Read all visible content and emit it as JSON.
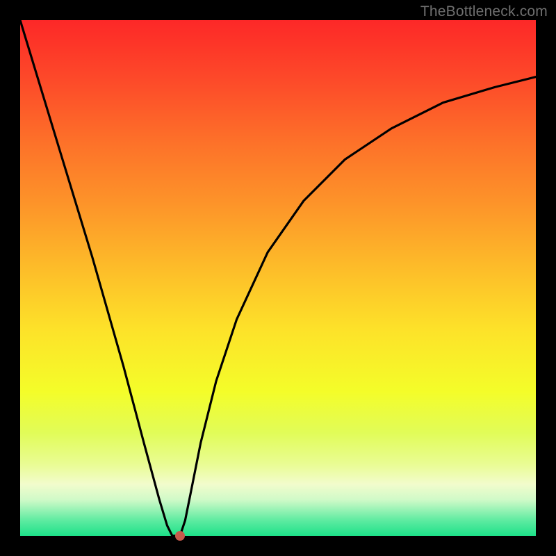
{
  "watermark": "TheBottleneck.com",
  "chart_data": {
    "type": "line",
    "title": "",
    "xlabel": "",
    "ylabel": "",
    "xlim": [
      0,
      100
    ],
    "ylim": [
      0,
      100
    ],
    "series": [
      {
        "name": "bottleneck-curve",
        "x": [
          0,
          7,
          14,
          20,
          24,
          27,
          28.5,
          29.5,
          30,
          31,
          32,
          33,
          35,
          38,
          42,
          48,
          55,
          63,
          72,
          82,
          92,
          100
        ],
        "values": [
          100,
          77,
          54,
          33,
          18,
          7,
          2,
          0,
          0,
          0,
          3,
          8,
          18,
          30,
          42,
          55,
          65,
          73,
          79,
          84,
          87,
          89
        ]
      }
    ],
    "marker": {
      "x": 31,
      "y": 0
    }
  },
  "colors": {
    "curve": "#000000",
    "dot": "#c75a4c"
  }
}
